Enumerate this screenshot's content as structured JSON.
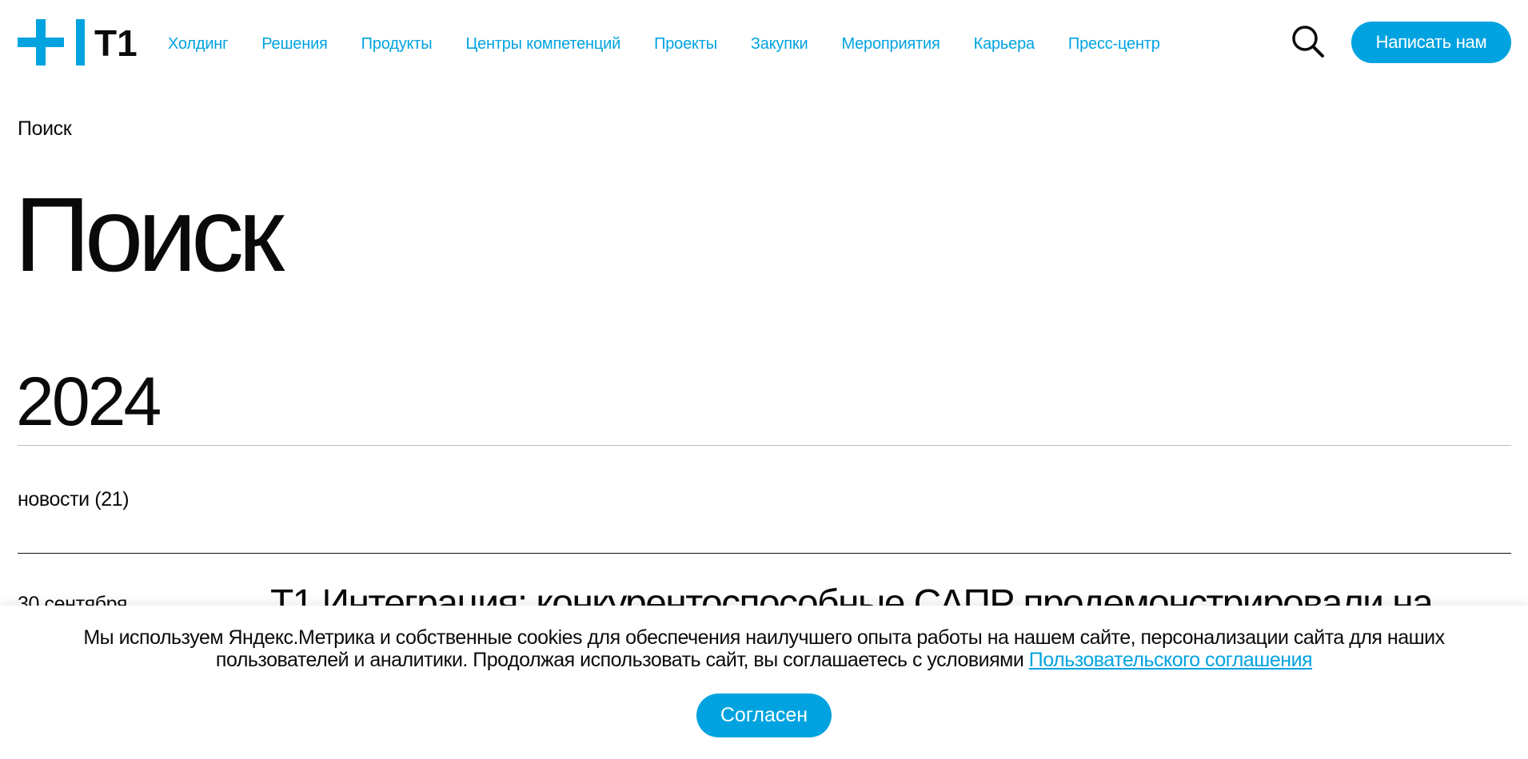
{
  "header": {
    "logo_text": "T1",
    "nav": [
      {
        "label": "Холдинг"
      },
      {
        "label": "Решения"
      },
      {
        "label": "Продукты"
      },
      {
        "label": "Центры компетенций"
      },
      {
        "label": "Проекты"
      },
      {
        "label": "Закупки"
      },
      {
        "label": "Мероприятия"
      },
      {
        "label": "Карьера"
      },
      {
        "label": "Пресс-центр"
      }
    ],
    "search_icon": "search-icon",
    "contact_label": "Написать нам"
  },
  "breadcrumb": "Поиск",
  "page_title": "Поиск",
  "results": {
    "year": "2024",
    "filter_label": "новости (21)",
    "items": [
      {
        "date": "30 сентября",
        "title": "Т1 Интеграция: конкурентоспособные САПР продемонстрировали на"
      }
    ]
  },
  "cookie": {
    "text": "Мы используем Яндекс.Метрика и собственные cookies для обеспечения наилучшего опыта работы на нашем сайте, персонализации сайта для наших пользователей и аналитики. Продолжая использовать сайт, вы соглашаетесь с условиями",
    "link_label": "Пользовательского соглашения",
    "button_label": "Согласен"
  },
  "colors": {
    "accent": "#00a3e0",
    "text": "#0a0a0a",
    "divider": "#b9bec4"
  }
}
